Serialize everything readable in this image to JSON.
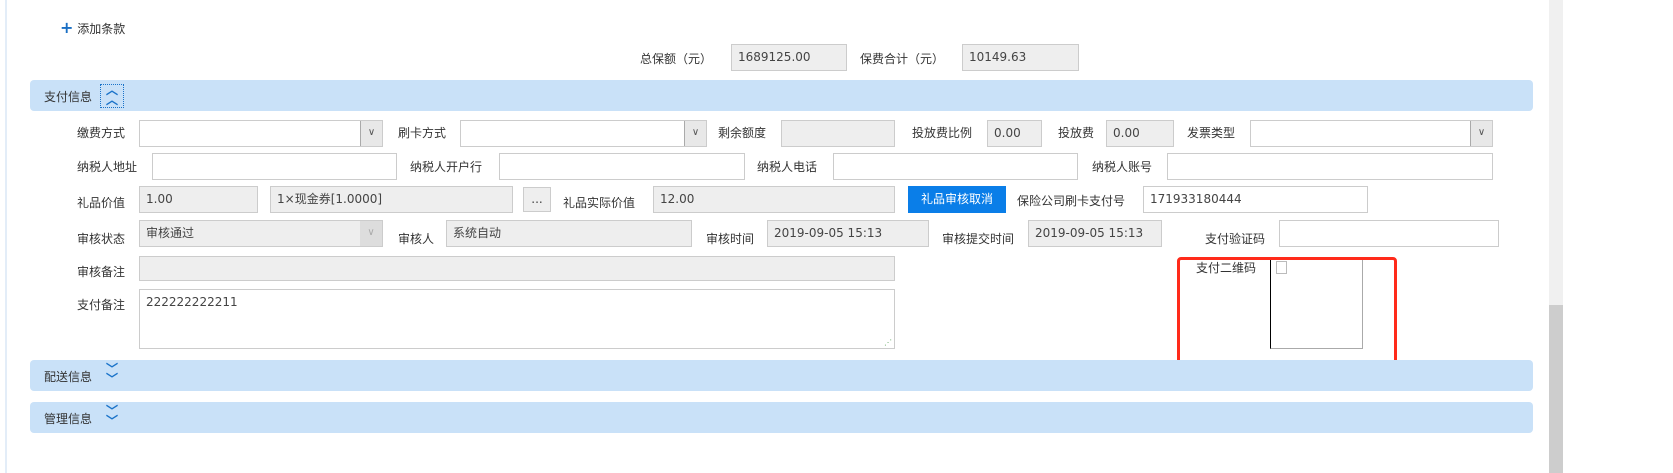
{
  "add_clause": "添加条款",
  "totals": {
    "sum_insured_label": "总保额（元）",
    "sum_insured": "1689125.00",
    "premium_label": "保费合计（元）",
    "premium": "10149.63"
  },
  "sections": {
    "payment": "支付信息",
    "delivery": "配送信息",
    "management": "管理信息"
  },
  "payment": {
    "pay_method_label": "缴费方式",
    "pay_method": "",
    "card_method_label": "刷卡方式",
    "card_method": "",
    "remaining_label": "剩余额度",
    "remaining": "",
    "fee_ratio_label": "投放费比例",
    "fee_ratio": "0.00",
    "fee_label": "投放费",
    "fee": "0.00",
    "invoice_type_label": "发票类型",
    "invoice_type": "",
    "taxpayer_address_label": "纳税人地址",
    "taxpayer_address": "",
    "taxpayer_bank_label": "纳税人开户行",
    "taxpayer_bank": "",
    "taxpayer_phone_label": "纳税人电话",
    "taxpayer_phone": "",
    "taxpayer_account_label": "纳税人账号",
    "taxpayer_account": "",
    "gift_value_label": "礼品价值",
    "gift_value": "1.00",
    "gift_desc": "1×现金券[1.0000]",
    "more_button": "...",
    "gift_actual_label": "礼品实际价值",
    "gift_actual": "12.00",
    "gift_cancel_button": "礼品审核取消",
    "card_pay_no_label": "保险公司刷卡支付号",
    "card_pay_no": "171933180444",
    "audit_status_label": "审核状态",
    "audit_status": "审核通过",
    "auditor_label": "审核人",
    "auditor": "系统自动",
    "audit_time_label": "审核时间",
    "audit_time": "2019-09-05 15:13",
    "audit_submit_time_label": "审核提交时间",
    "audit_submit_time": "2019-09-05 15:13",
    "verify_code_label": "支付验证码",
    "verify_code": "",
    "audit_remark_label": "审核备注",
    "audit_remark": "",
    "qr_label": "支付二维码",
    "pay_remark_label": "支付备注",
    "pay_remark": "222222222211"
  },
  "colors": {
    "accent": "#0a7ee8",
    "section_bg": "#c9e1f8",
    "highlight": "#ff2a1a"
  }
}
